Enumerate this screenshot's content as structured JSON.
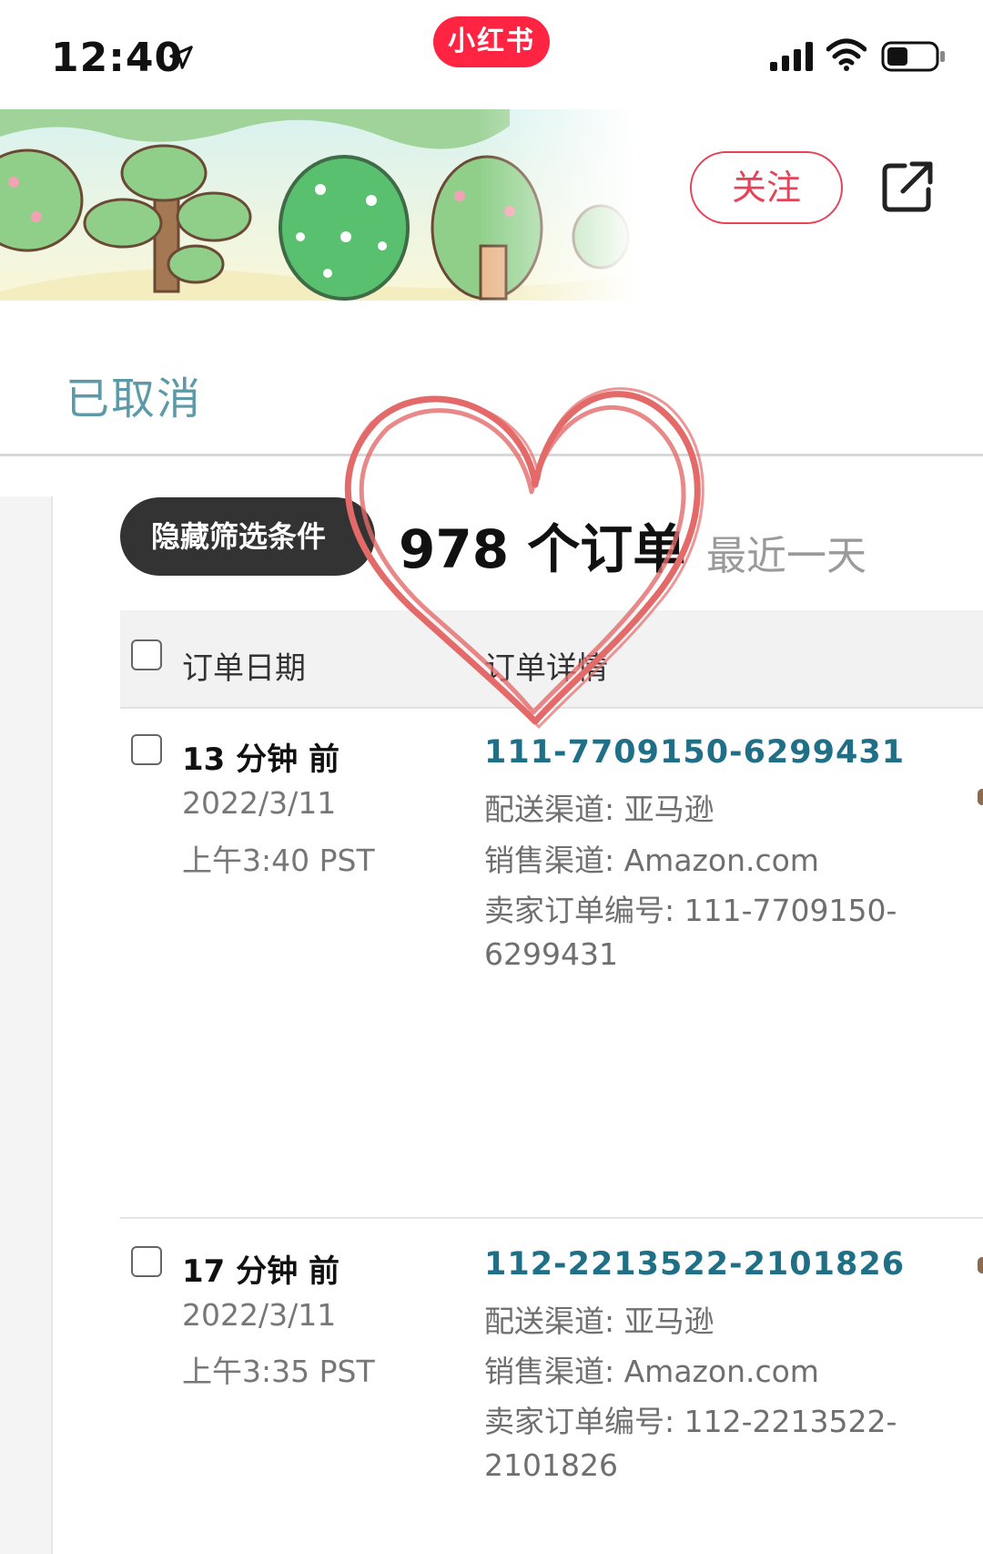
{
  "status_bar": {
    "time": "12:40",
    "app_badge": "小红书",
    "app_badge_color": "#ff2442",
    "icons": [
      "location-arrow-icon",
      "signal-icon",
      "wifi-icon",
      "battery-icon"
    ]
  },
  "header": {
    "follow_label": "关注",
    "share_icon": "share-icon",
    "accent_color": "#e6435b"
  },
  "section": {
    "tab_label": "已取消"
  },
  "filter": {
    "button_label": "隐藏筛选条件",
    "order_count": "978 个订单",
    "range_label": "最近一天"
  },
  "table": {
    "columns": [
      "订单日期",
      "订单详情"
    ],
    "rows": [
      {
        "relative_time": "13 分钟 前",
        "date": "2022/3/11",
        "time": "上午3:40 PST",
        "order_id": "111-7709150-6299431",
        "channel": "配送渠道: 亚马逊",
        "sales_channel": "销售渠道: Amazon.com",
        "seller_order_line1": "卖家订单编号: 111-7709150-",
        "seller_order_line2": "6299431"
      },
      {
        "relative_time": "17 分钟 前",
        "date": "2022/3/11",
        "time": "上午3:35 PST",
        "order_id": "112-2213522-2101826",
        "channel": "配送渠道: 亚马逊",
        "sales_channel": "销售渠道: Amazon.com",
        "seller_order_line1": "卖家订单编号: 112-2213522-",
        "seller_order_line2": "2101826"
      }
    ],
    "link_color": "#1f6f86"
  }
}
